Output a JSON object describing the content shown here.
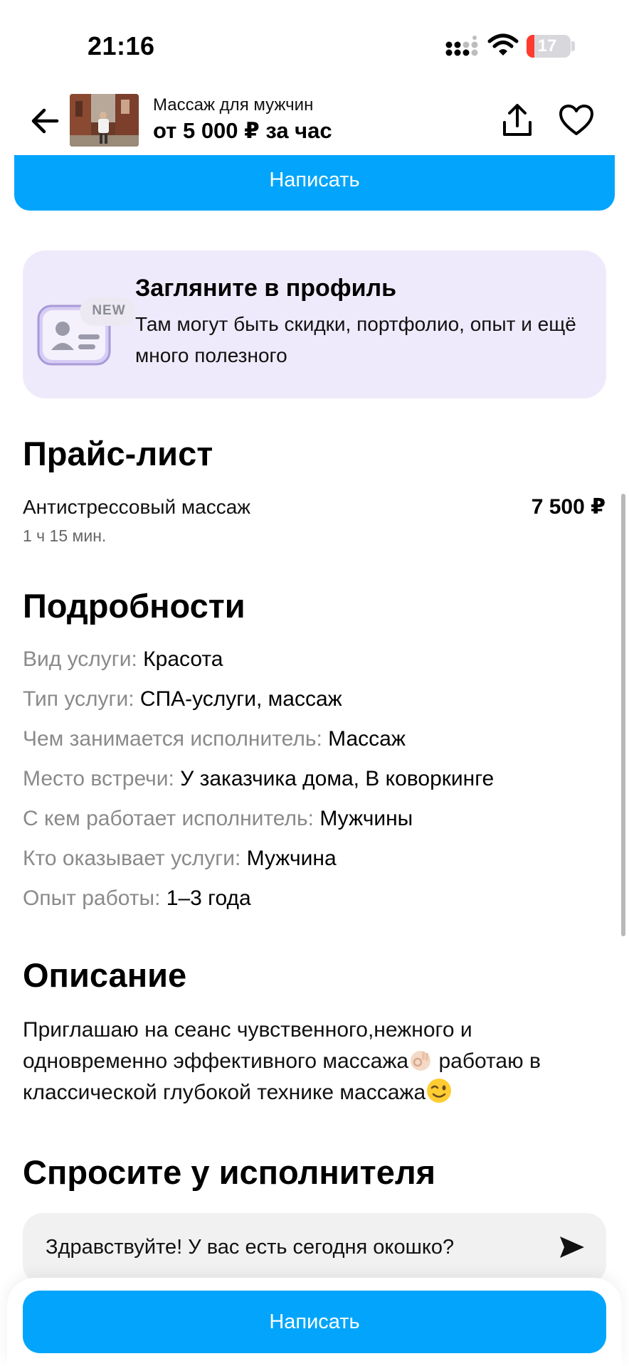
{
  "status_bar": {
    "time": "21:16",
    "battery": "17",
    "battery_level": 0.17
  },
  "header": {
    "title": "Массаж для мужчин",
    "price": "от 5 000 ₽ за час"
  },
  "top_write_label": "Написать",
  "profile_banner": {
    "badge": "NEW",
    "title": "Загляните в профиль",
    "text": "Там могут быть скидки, портфолио, опыт и ещё много полезного"
  },
  "price_list": {
    "heading": "Прайс-лист",
    "items": [
      {
        "name": "Антистрессовый массаж",
        "duration": "1 ч 15 мин.",
        "price": "7 500 ₽"
      }
    ]
  },
  "details": {
    "heading": "Подробности",
    "items": [
      {
        "label": "Вид услуги:",
        "value": "Красота"
      },
      {
        "label": "Тип услуги:",
        "value": "СПА-услуги, массаж"
      },
      {
        "label": "Чем занимается исполнитель:",
        "value": "Массаж"
      },
      {
        "label": "Место встречи:",
        "value": "У заказчика дома, В коворкинге"
      },
      {
        "label": "С кем работает исполнитель:",
        "value": "Мужчины"
      },
      {
        "label": "Кто оказывает услуги:",
        "value": "Мужчина"
      },
      {
        "label": "Опыт работы:",
        "value": "1–3 года"
      }
    ]
  },
  "description": {
    "heading": "Описание",
    "line1": "Приглашаю на сеанс чувственного,нежного и",
    "line2a": "одновременно эффективного массажа",
    "line2b": " работаю в",
    "line3": "классической глубокой технике массажа"
  },
  "ask": {
    "heading": "Спросите у исполнителя",
    "message": "Здравствуйте! У вас есть сегодня окошко?"
  },
  "bottom_write_label": "Написать",
  "colors": {
    "accent": "#02a5fb",
    "banner_bg": "#efeafb",
    "label_gray": "#8a8a8a"
  }
}
